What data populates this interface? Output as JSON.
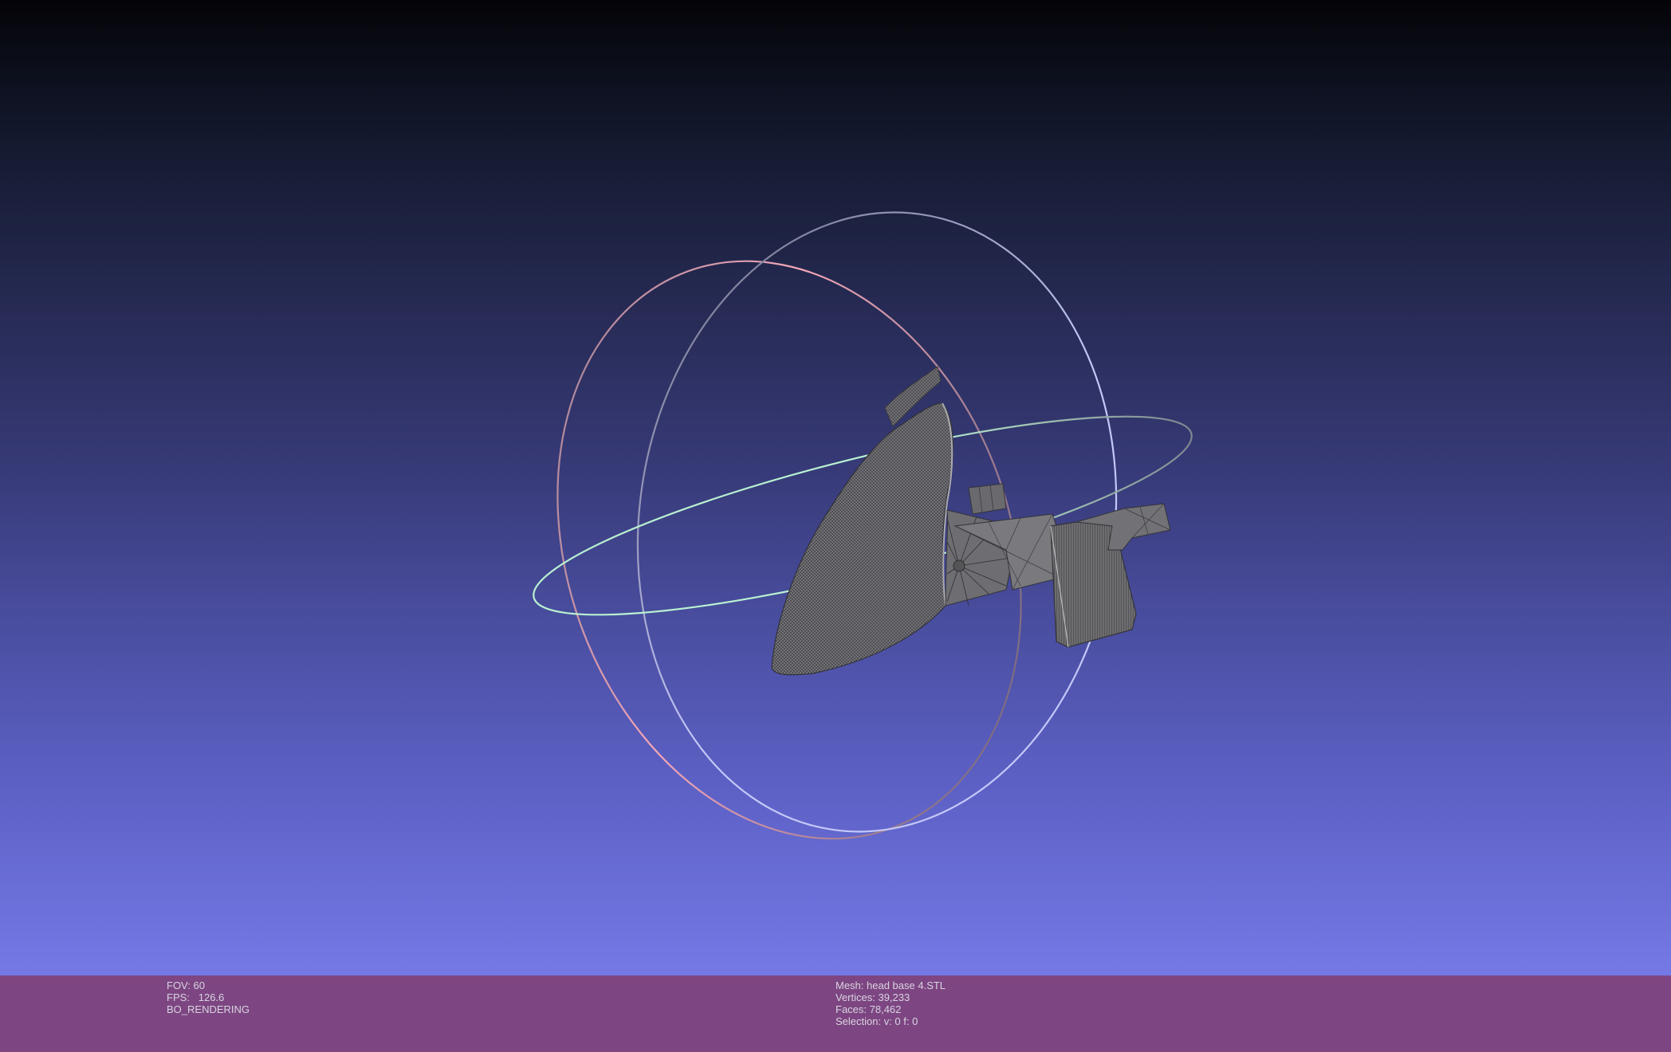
{
  "viewport": {
    "background_top": "#040408",
    "background_bottom": "#7479e6",
    "mesh_color": "#5a5a5a",
    "trackball_colors": {
      "red_ring": "#f2a6b8",
      "green_ring": "#b9f2d2",
      "blue_ring": "#c4c8f8"
    }
  },
  "status_bar": {
    "background": "#7d4682",
    "left": {
      "fov": "FOV: 60",
      "fps": "FPS:   126.6",
      "mode": "BO_RENDERING"
    },
    "right": {
      "mesh": "Mesh: head base 4.STL",
      "vertices": "Vertices: 39,233",
      "faces": "Faces: 78,462",
      "selection": "Selection: v: 0 f: 0"
    }
  }
}
